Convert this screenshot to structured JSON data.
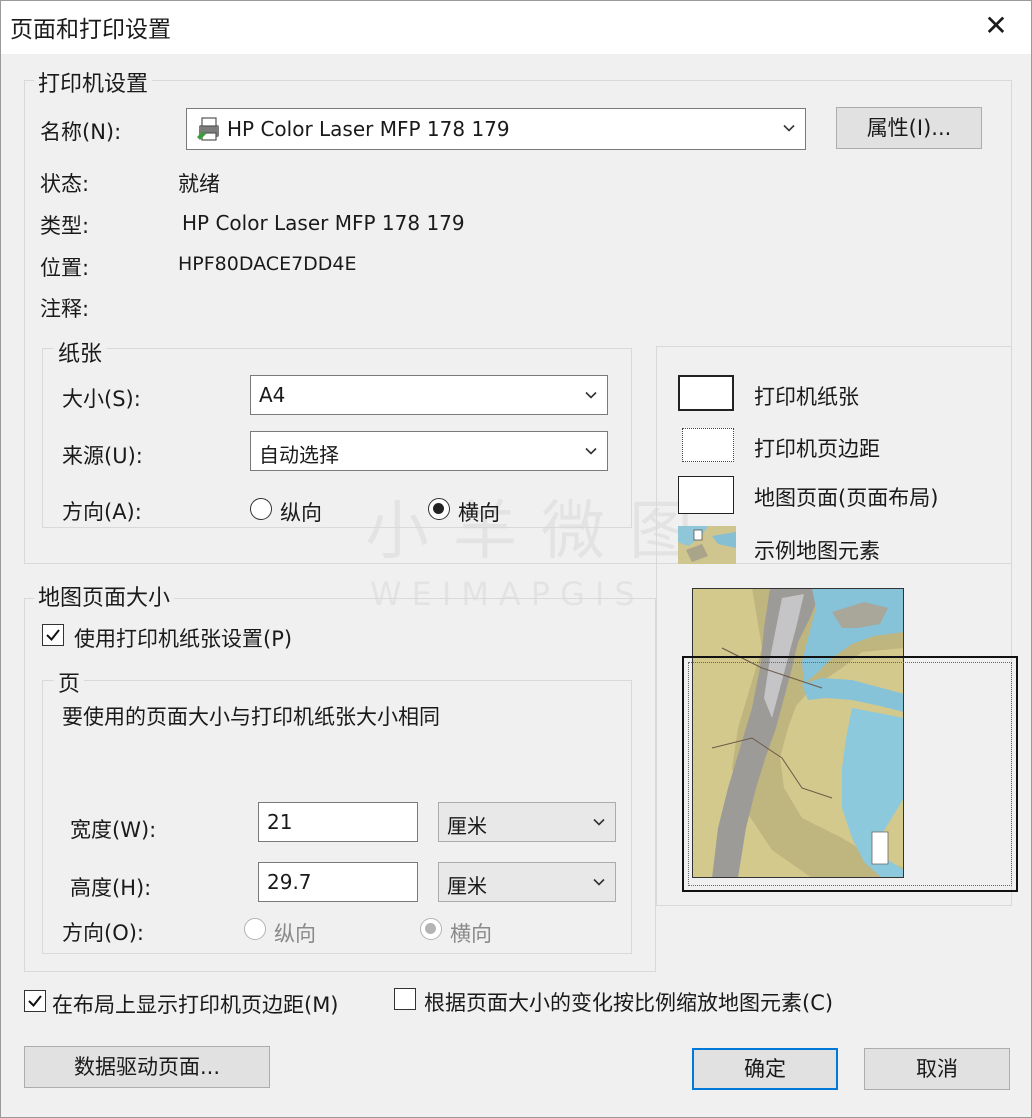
{
  "window": {
    "title": "页面和打印设置",
    "close_glyph": "✕"
  },
  "printer": {
    "group_label": "打印机设置",
    "name_label": "名称(N):",
    "name_value": "HP Color Laser MFP 178 179",
    "properties_button": "属性(I)...",
    "status_label": "状态:",
    "status_value": "就绪",
    "type_label": "类型:",
    "type_value": "HP Color Laser MFP 178 179",
    "location_label": "位置:",
    "location_value": "HPF80DACE7DD4E",
    "comment_label": "注释:"
  },
  "paper": {
    "group_label": "纸张",
    "size_label": "大小(S):",
    "size_value": "A4",
    "source_label": "来源(U):",
    "source_value": "自动选择",
    "orientation_label": "方向(A):",
    "portrait_label": "纵向",
    "landscape_label": "横向",
    "selected": "landscape"
  },
  "legend": {
    "printer_paper": "打印机纸张",
    "printer_margin": "打印机页边距",
    "map_page": "地图页面(页面布局)",
    "sample_elements": "示例地图元素"
  },
  "map_page_size": {
    "group_label": "地图页面大小",
    "use_printer_settings_label": "使用打印机纸张设置(P)",
    "use_printer_settings_checked": true,
    "page_group_label": "页",
    "note": "要使用的页面大小与打印机纸张大小相同",
    "width_label": "宽度(W):",
    "width_value": "21",
    "width_unit": "厘米",
    "height_label": "高度(H):",
    "height_value": "29.7",
    "height_unit": "厘米",
    "orientation_label": "方向(O):",
    "portrait_label": "纵向",
    "landscape_label": "横向",
    "selected": "landscape"
  },
  "options": {
    "show_margins_label": "在布局上显示打印机页边距(M)",
    "show_margins_checked": true,
    "scale_elements_label": "根据页面大小的变化按比例缩放地图元素(C)",
    "scale_elements_checked": false
  },
  "buttons": {
    "data_driven_pages": "数据驱动页面...",
    "ok": "确定",
    "cancel": "取消"
  },
  "watermark": {
    "line1": "小羊微图",
    "line2": "WEIMAPGIS"
  },
  "colors": {
    "accent": "#0078d7",
    "window_bg": "#f0f0f0",
    "titlebar_bg": "#ffffff"
  }
}
